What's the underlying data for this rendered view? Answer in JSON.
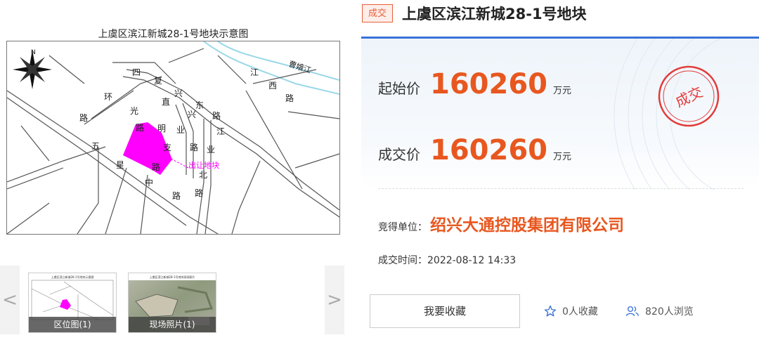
{
  "map": {
    "title": "上虞区滨江新城28-1号地块示意图",
    "labels": {
      "parcel": "出让地块",
      "road_ring": [
        "四",
        "环",
        "路"
      ],
      "road_fuxing": [
        "复",
        "兴",
        "直"
      ],
      "road_guangming": [
        "光",
        "明",
        "路",
        "支",
        "路"
      ],
      "road_wuxing": [
        "五",
        "星",
        "中",
        "路"
      ],
      "road_dongxing": [
        "东",
        "兴",
        "路"
      ],
      "road_xingye": [
        "业",
        "路",
        "业",
        "北"
      ],
      "road_jiang": [
        "江",
        "西",
        "路"
      ],
      "river": "曹娥江",
      "jiang_char": "江",
      "north": "N"
    },
    "colors": {
      "parcel": "#ff00ff",
      "road": "#555555",
      "river": "#9ad8e8"
    }
  },
  "thumbnails": {
    "prev_arrow": "<",
    "next_arrow": ">",
    "items": [
      {
        "caption": "区位图(1)",
        "mini_title": "上虞区滨江新城28-1号地块示意图"
      },
      {
        "caption": "现场照片(1)",
        "mini_title": "上虞区滨江新城28-1号地块现场照片"
      }
    ]
  },
  "header": {
    "status_badge": "成交",
    "title": "上虞区滨江新城28-1号地块"
  },
  "prices": {
    "start_label": "起始价",
    "start_value": "160260",
    "start_unit": "万元",
    "deal_label": "成交价",
    "deal_value": "160260",
    "deal_unit": "万元"
  },
  "stamp_text": "成交",
  "winner": {
    "label": "竞得单位：",
    "value": "绍兴大通控股集团有限公司"
  },
  "deal_time": "成交时间：2022-08-12 14:33",
  "actions": {
    "favorite_button": "我要收藏",
    "favorites_count": "0人收藏",
    "views_count": "820人浏览"
  },
  "colors": {
    "accent": "#e8571f",
    "blue_line": "#3a72d8",
    "icon_blue": "#3a72d8"
  }
}
